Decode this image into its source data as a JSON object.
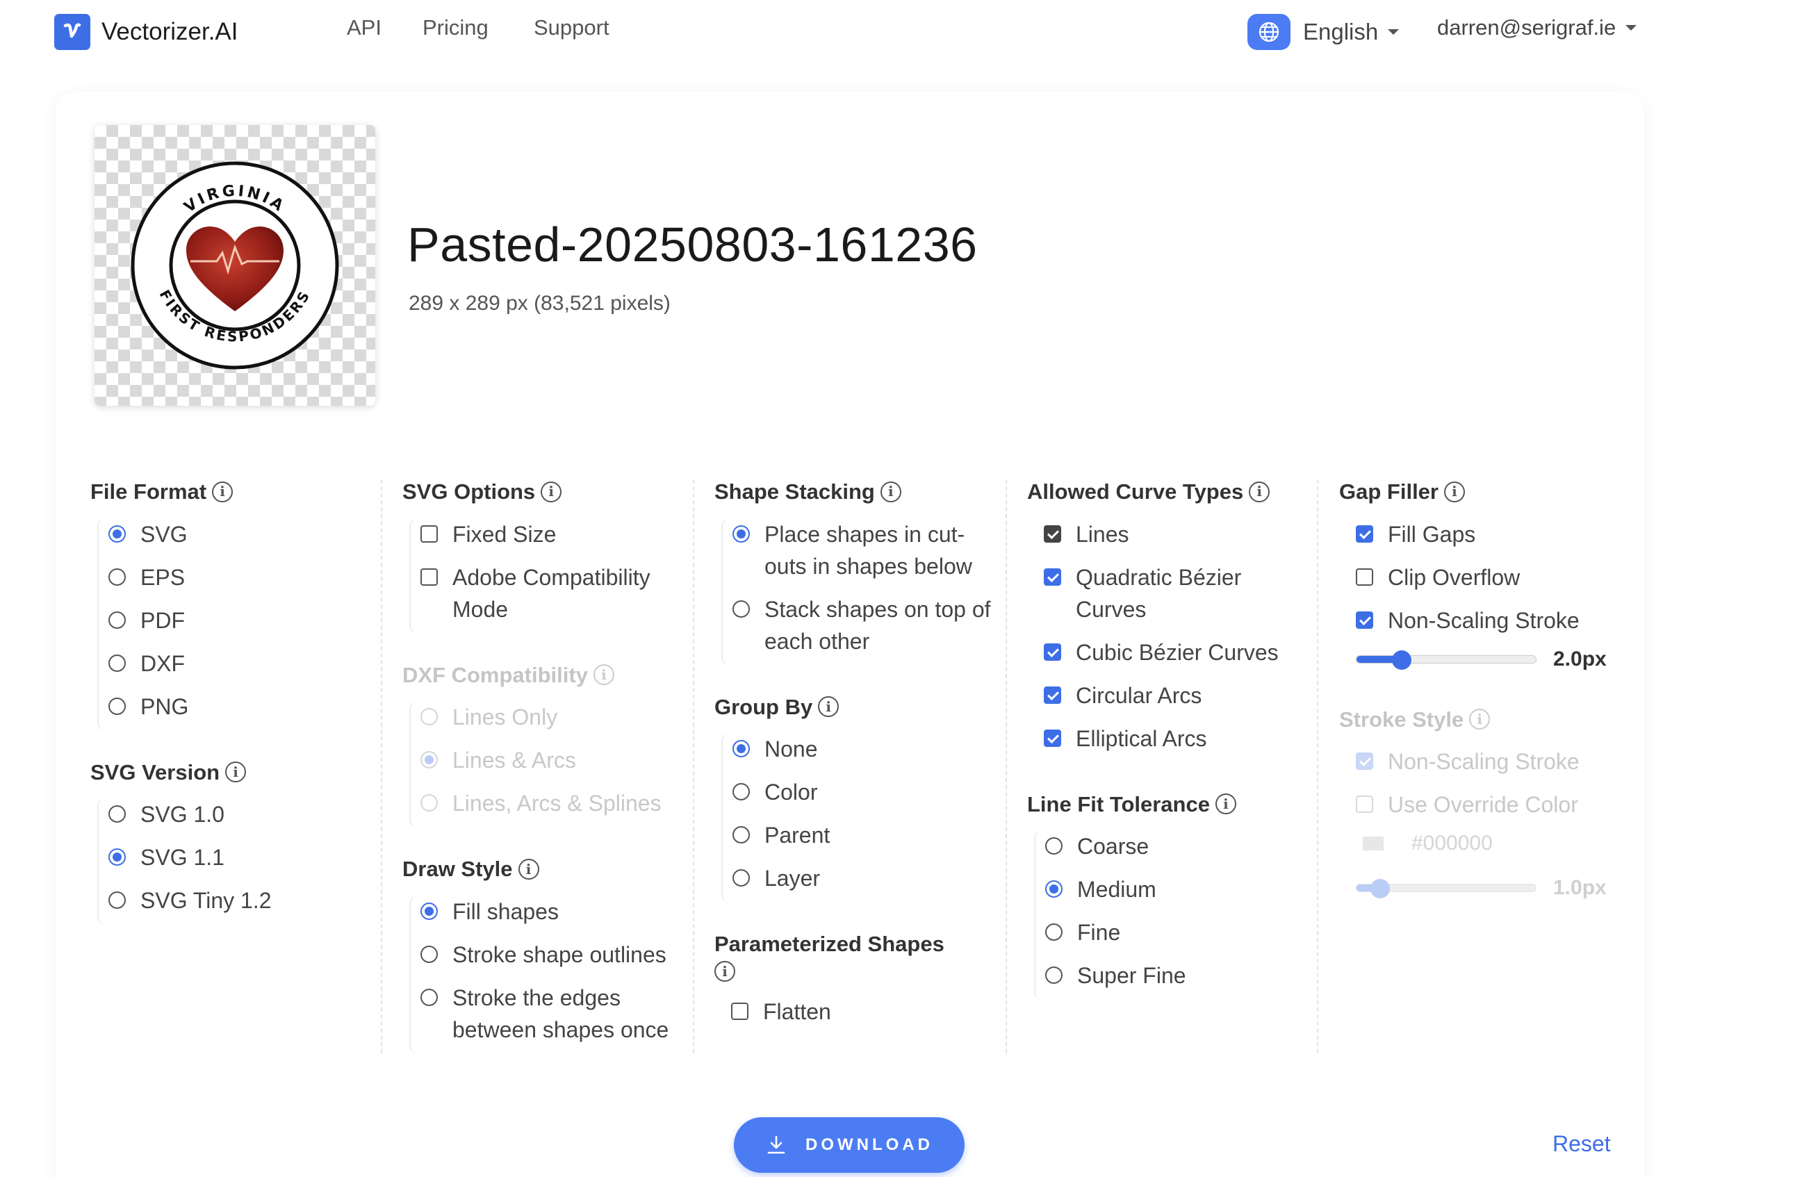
{
  "header": {
    "brand": "Vectorizer.AI",
    "nav": [
      "API",
      "Pricing",
      "Support"
    ],
    "language": "English",
    "account": "darren@serigraf.ie",
    "accent": "#3d6ee6"
  },
  "image": {
    "title": "Pasted-20250803-161236",
    "dimensions": "289 x 289 px (83,521 pixels)",
    "preview_texts": {
      "top": "VIRGINIA",
      "bottom": "FIRST RESPONDERS"
    }
  },
  "file_format": {
    "title": "File Format",
    "options": [
      "SVG",
      "EPS",
      "PDF",
      "DXF",
      "PNG"
    ],
    "selected": "SVG"
  },
  "svg_version": {
    "title": "SVG Version",
    "options": [
      "SVG 1.0",
      "SVG 1.1",
      "SVG Tiny 1.2"
    ],
    "selected": "SVG 1.1"
  },
  "svg_options": {
    "title": "SVG Options",
    "options": [
      "Fixed Size",
      "Adobe Compatibility Mode"
    ]
  },
  "dxf_compat": {
    "title": "DXF Compatibility",
    "options": [
      "Lines Only",
      "Lines & Arcs",
      "Lines, Arcs & Splines"
    ],
    "selected": "Lines & Arcs"
  },
  "draw_style": {
    "title": "Draw Style",
    "options": [
      "Fill shapes",
      "Stroke shape outlines",
      "Stroke the edges between shapes once"
    ],
    "selected": "Fill shapes"
  },
  "shape_stacking": {
    "title": "Shape Stacking",
    "options": [
      "Place shapes in cut-outs in shapes below",
      "Stack shapes on top of each other"
    ],
    "selected": "Place shapes in cut-outs in shapes below"
  },
  "group_by": {
    "title": "Group By",
    "options": [
      "None",
      "Color",
      "Parent",
      "Layer"
    ],
    "selected": "None"
  },
  "parameterized": {
    "title": "Parameterized Shapes",
    "options": [
      "Flatten"
    ]
  },
  "curve_types": {
    "title": "Allowed Curve Types",
    "options": [
      "Lines",
      "Quadratic Bézier Curves",
      "Cubic Bézier Curves",
      "Circular Arcs",
      "Elliptical Arcs"
    ]
  },
  "line_fit": {
    "title": "Line Fit Tolerance",
    "options": [
      "Coarse",
      "Medium",
      "Fine",
      "Super Fine"
    ],
    "selected": "Medium"
  },
  "gap_filler": {
    "title": "Gap Filler",
    "options": [
      "Fill Gaps",
      "Clip Overflow",
      "Non-Scaling Stroke"
    ],
    "stroke_value": "2.0px",
    "stroke_fraction": 0.25
  },
  "stroke_style": {
    "title": "Stroke Style",
    "options": [
      "Non-Scaling Stroke",
      "Use Override Color"
    ],
    "color": "#000000",
    "width_value": "1.0px",
    "width_fraction": 0.13
  },
  "footer": {
    "download": "DOWNLOAD",
    "reset": "Reset"
  }
}
